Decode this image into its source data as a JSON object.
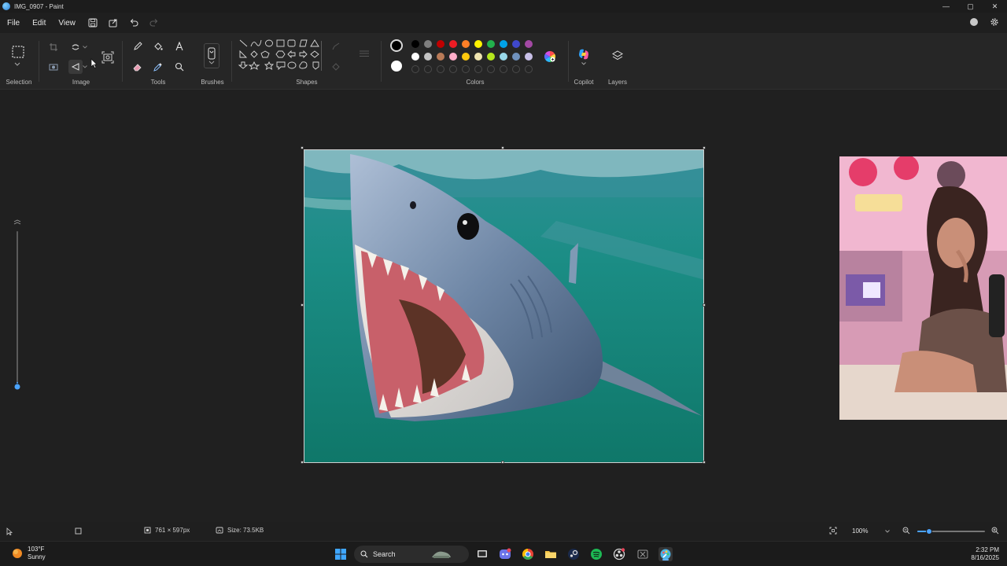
{
  "window": {
    "title": "IMG_0907 - Paint",
    "controls": {
      "minimize": "—",
      "maximize": "▢",
      "close": "✕"
    }
  },
  "menu": {
    "file": "File",
    "edit": "Edit",
    "view": "View"
  },
  "ribbon": {
    "groups": {
      "selection": "Selection",
      "image": "Image",
      "tools": "Tools",
      "brushes": "Brushes",
      "shapes": "Shapes",
      "colors": "Colors",
      "copilot": "Copilot",
      "layers": "Layers"
    },
    "palette_row1": [
      "#000000",
      "#7f7f7f",
      "#c00000",
      "#ed1c24",
      "#ff7f27",
      "#fff200",
      "#22b14c",
      "#00a2e8",
      "#3f48cc",
      "#a349a4"
    ],
    "palette_row2": [
      "#ffffff",
      "#c3c3c3",
      "#b97a57",
      "#ffaec9",
      "#ffc90e",
      "#efe4b0",
      "#b5e61d",
      "#99d9ea",
      "#7092be",
      "#c8bfe7"
    ],
    "primary_color": "#000000",
    "secondary_color": "#ffffff"
  },
  "canvas": {
    "image_alt": "Shark with open jaws underwater"
  },
  "statusbar": {
    "dimensions": "761 × 597px",
    "size": "Size: 73.5KB",
    "zoom": "100%",
    "zoom_level": 0.17
  },
  "taskbar": {
    "weather_temp": "103°F",
    "weather_desc": "Sunny",
    "search_label": "Search",
    "time": "2:32 PM",
    "date": "8/16/2025"
  },
  "colors": {
    "accent": "#4aa3ff",
    "water": "#1f8f86"
  }
}
